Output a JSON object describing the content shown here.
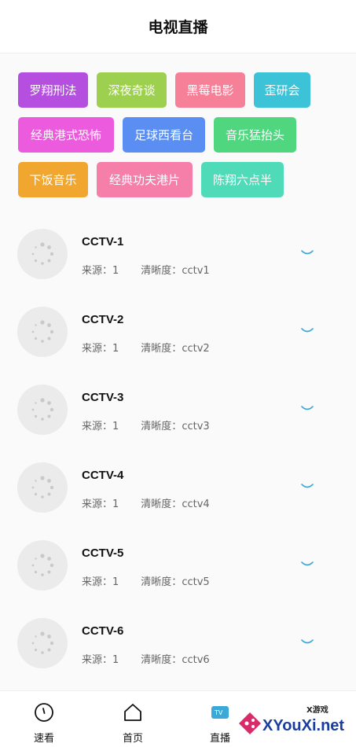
{
  "header": {
    "title": "电视直播"
  },
  "tags": [
    {
      "label": "罗翔刑法",
      "color": "#b44fe0"
    },
    {
      "label": "深夜奇谈",
      "color": "#9ed04f"
    },
    {
      "label": "黑莓电影",
      "color": "#f58097"
    },
    {
      "label": "歪研会",
      "color": "#3cc3d8"
    },
    {
      "label": "经典港式恐怖",
      "color": "#ec5bdd"
    },
    {
      "label": "足球西看台",
      "color": "#5b8ef2"
    },
    {
      "label": "音乐猛抬头",
      "color": "#4fd67f"
    },
    {
      "label": "下饭音乐",
      "color": "#f0a62f"
    },
    {
      "label": "经典功夫港片",
      "color": "#f57fa8"
    },
    {
      "label": "陈翔六点半",
      "color": "#4fdbb8"
    }
  ],
  "channels": [
    {
      "name": "CCTV-1",
      "source_label": "来源：",
      "source": "1",
      "quality_label": "清晰度：",
      "quality": "cctv1"
    },
    {
      "name": "CCTV-2",
      "source_label": "来源：",
      "source": "1",
      "quality_label": "清晰度：",
      "quality": "cctv2"
    },
    {
      "name": "CCTV-3",
      "source_label": "来源：",
      "source": "1",
      "quality_label": "清晰度：",
      "quality": "cctv3"
    },
    {
      "name": "CCTV-4",
      "source_label": "来源：",
      "source": "1",
      "quality_label": "清晰度：",
      "quality": "cctv4"
    },
    {
      "name": "CCTV-5",
      "source_label": "来源：",
      "source": "1",
      "quality_label": "清晰度：",
      "quality": "cctv5"
    },
    {
      "name": "CCTV-6",
      "source_label": "来源：",
      "source": "1",
      "quality_label": "清晰度：",
      "quality": "cctv6"
    }
  ],
  "tabbar": {
    "tabs": [
      {
        "label": "速看",
        "icon": "clock-icon"
      },
      {
        "label": "首页",
        "icon": "home-icon"
      },
      {
        "label": "直播",
        "icon": "tv-icon"
      }
    ]
  },
  "watermark": {
    "small": "X游戏",
    "text": "XYouXi.net"
  },
  "colors": {
    "chevron": "#3aa9d8",
    "accent_watermark": "#1a3d9e"
  }
}
